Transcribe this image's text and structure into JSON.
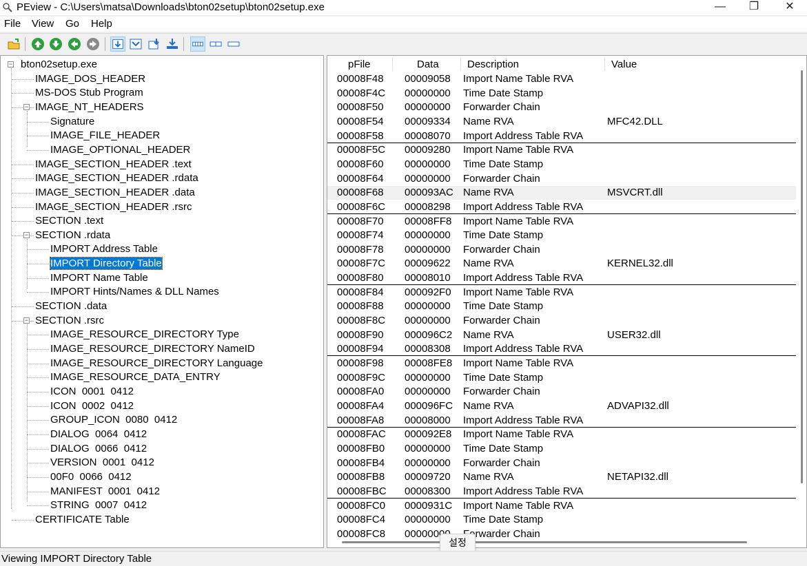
{
  "window": {
    "title": "PEview - C:\\Users\\matsa\\Downloads\\bton02setup\\bton02setup.exe",
    "min_glyph": "—",
    "max_glyph": "❐",
    "close_glyph": "✕"
  },
  "menu": [
    "File",
    "View",
    "Go",
    "Help"
  ],
  "toolbar": {
    "icons": [
      "open-file-icon",
      "up-icon",
      "down-icon",
      "back-icon",
      "forward-icon",
      "view-hex-icon",
      "view-cmd-icon",
      "view-scroll-icon",
      "view-dump-icon",
      "view-byte-icon",
      "view-word-icon",
      "view-dword-icon"
    ],
    "accent_blue": "#1e6fd0",
    "accent_green": "#2e9e3e"
  },
  "tree": {
    "root": "bton02setup.exe",
    "items": [
      "IMAGE_DOS_HEADER",
      "MS-DOS Stub Program",
      "IMAGE_NT_HEADERS",
      "Signature",
      "IMAGE_FILE_HEADER",
      "IMAGE_OPTIONAL_HEADER",
      "IMAGE_SECTION_HEADER .text",
      "IMAGE_SECTION_HEADER .rdata",
      "IMAGE_SECTION_HEADER .data",
      "IMAGE_SECTION_HEADER .rsrc",
      "SECTION .text",
      "SECTION .rdata",
      "IMPORT Address Table",
      "IMPORT Directory Table",
      "IMPORT Name Table",
      "IMPORT Hints/Names & DLL Names",
      "SECTION .data",
      "SECTION .rsrc",
      "IMAGE_RESOURCE_DIRECTORY Type",
      "IMAGE_RESOURCE_DIRECTORY NameID",
      "IMAGE_RESOURCE_DIRECTORY Language",
      "IMAGE_RESOURCE_DATA_ENTRY",
      "ICON  0001  0412",
      "ICON  0002  0412",
      "GROUP_ICON  0080  0412",
      "DIALOG  0064  0412",
      "DIALOG  0066  0412",
      "VERSION  0001  0412",
      "00F0  0066  0412",
      "MANIFEST  0001  0412",
      "STRING  0007  0412",
      "CERTIFICATE Table"
    ],
    "selected": "IMPORT Directory Table",
    "selection_color": "#0078d7"
  },
  "list": {
    "columns": [
      "pFile",
      "Data",
      "Description",
      "Value"
    ],
    "rows": [
      [
        "00008F48",
        "00009058",
        "Import Name Table RVA",
        ""
      ],
      [
        "00008F4C",
        "00000000",
        "Time Date Stamp",
        ""
      ],
      [
        "00008F50",
        "00000000",
        "Forwarder Chain",
        ""
      ],
      [
        "00008F54",
        "00009334",
        "Name RVA",
        "MFC42.DLL"
      ],
      [
        "00008F58",
        "00008070",
        "Import Address Table RVA",
        ""
      ],
      [
        "00008F5C",
        "00009280",
        "Import Name Table RVA",
        ""
      ],
      [
        "00008F60",
        "00000000",
        "Time Date Stamp",
        ""
      ],
      [
        "00008F64",
        "00000000",
        "Forwarder Chain",
        ""
      ],
      [
        "00008F68",
        "000093AC",
        "Name RVA",
        "MSVCRT.dll"
      ],
      [
        "00008F6C",
        "00008298",
        "Import Address Table RVA",
        ""
      ],
      [
        "00008F70",
        "00008FF8",
        "Import Name Table RVA",
        ""
      ],
      [
        "00008F74",
        "00000000",
        "Time Date Stamp",
        ""
      ],
      [
        "00008F78",
        "00000000",
        "Forwarder Chain",
        ""
      ],
      [
        "00008F7C",
        "00009622",
        "Name RVA",
        "KERNEL32.dll"
      ],
      [
        "00008F80",
        "00008010",
        "Import Address Table RVA",
        ""
      ],
      [
        "00008F84",
        "000092F0",
        "Import Name Table RVA",
        ""
      ],
      [
        "00008F88",
        "00000000",
        "Time Date Stamp",
        ""
      ],
      [
        "00008F8C",
        "00000000",
        "Forwarder Chain",
        ""
      ],
      [
        "00008F90",
        "000096C2",
        "Name RVA",
        "USER32.dll"
      ],
      [
        "00008F94",
        "00008308",
        "Import Address Table RVA",
        ""
      ],
      [
        "00008F98",
        "00008FE8",
        "Import Name Table RVA",
        ""
      ],
      [
        "00008F9C",
        "00000000",
        "Time Date Stamp",
        ""
      ],
      [
        "00008FA0",
        "00000000",
        "Forwarder Chain",
        ""
      ],
      [
        "00008FA4",
        "000096FC",
        "Name RVA",
        "ADVAPI32.dll"
      ],
      [
        "00008FA8",
        "00008000",
        "Import Address Table RVA",
        ""
      ],
      [
        "00008FAC",
        "000092E8",
        "Import Name Table RVA",
        ""
      ],
      [
        "00008FB0",
        "00000000",
        "Time Date Stamp",
        ""
      ],
      [
        "00008FB4",
        "00000000",
        "Forwarder Chain",
        ""
      ],
      [
        "00008FB8",
        "00009720",
        "Name RVA",
        "NETAPI32.dll"
      ],
      [
        "00008FBC",
        "00008300",
        "Import Address Table RVA",
        ""
      ],
      [
        "00008FC0",
        "0000931C",
        "Import Name Table RVA",
        ""
      ],
      [
        "00008FC4",
        "00000000",
        "Time Date Stamp",
        ""
      ],
      [
        "00008FC8",
        "00000000",
        "Forwarder Chain",
        ""
      ]
    ],
    "highlighted_row": "00008F68"
  },
  "tooltip": "설정",
  "status": "Viewing IMPORT Directory Table"
}
